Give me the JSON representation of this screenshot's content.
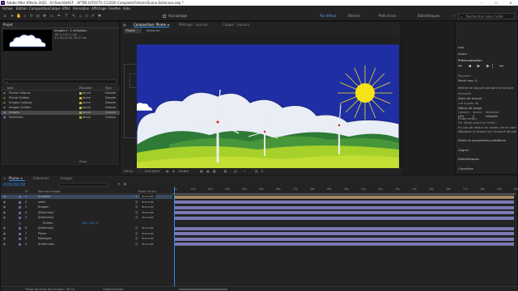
{
  "app": {
    "title": "Adobe After Effects 2022 - D:\\Teach\\HACF - AFTER EFFECTS CC2020 Complete\\Fichiers\\Scene Eoliennes.aep *",
    "logo_text": "Ae",
    "window_controls": [
      "–",
      "☐",
      "✕"
    ]
  },
  "menu": [
    "Fichier",
    "Edition",
    "Composition",
    "Calque",
    "Effet",
    "Animation",
    "Affichage",
    "Fenêtre",
    "Aide"
  ],
  "toolbar": {
    "snap_label": "Accrochage",
    "workspaces": [
      "Par défaut",
      "Réviser",
      "Petit écran",
      "Bibliothèques"
    ],
    "search_placeholder": "Rechercher dans l'aide"
  },
  "project_panel": {
    "tab": "Projet",
    "thumb_name": "Images ▾ , 2 utilisation",
    "thumb_info_1": "187 x 150 (1,00)",
    "thumb_info_2": "Δ 0;00;10;00, 29,97 ips",
    "search_placeholder": "",
    "columns": [
      "Nom",
      "Étiquette",
      "Type"
    ],
    "items": [
      {
        "name": "Plume Calques",
        "label": "Jaune",
        "type": "Dossier",
        "color": "#c9b23a"
      },
      {
        "name": "Plume Solides",
        "label": "Jaune",
        "type": "Dossier",
        "color": "#c9b23a"
      },
      {
        "name": "Images Calques",
        "label": "Jaune",
        "type": "Dossier",
        "color": "#c9b23a"
      },
      {
        "name": "Images Solides",
        "label": "Jaune",
        "type": "Dossier",
        "color": "#c9b23a"
      },
      {
        "name": "Images",
        "label": "Jaune",
        "type": "Compo",
        "color": "#9aa43b"
      },
      {
        "name": "Eoliennes",
        "label": "Jaune",
        "type": "Compo",
        "color": "#9aa43b"
      }
    ],
    "bottom": "8 bpc"
  },
  "composition": {
    "tabs": [
      "Composition: Plume ≡",
      "Métrage : (aucun)",
      "Calque : (aucun)"
    ],
    "sub_tabs": [
      "Plume",
      "Eoliennes"
    ],
    "zoom": "(50 %)",
    "quality": "Entière",
    "timecode": "0;00;00;00"
  },
  "timeline": {
    "tabs": [
      "Plume ≡",
      "Eoliennes",
      "Images"
    ],
    "timecode": "0;00;00;00",
    "columns": [
      "N°",
      "Nom des images",
      "Parent et lien"
    ],
    "layers": [
      {
        "num": "1",
        "name": "[Images]",
        "parent": "Aucun(e)",
        "color": "#6b6b9e",
        "selected": true
      },
      {
        "num": "2",
        "name": "soleil",
        "parent": "Aucun(e)",
        "color": "#6b6b9e"
      },
      {
        "num": "3",
        "name": "Nuages",
        "parent": "Aucun(e)",
        "color": "#6b6b9e"
      },
      {
        "num": "4",
        "name": "[Eoliennes]",
        "parent": "Aucun(e)",
        "color": "#6b6b9e"
      },
      {
        "num": "5",
        "name": "[Eoliennes]",
        "parent": "Aucun(e)",
        "color": "#6b6b9e"
      },
      {
        "num": "",
        "name": "Échelle",
        "parent": "",
        "color": "#3f3f3f",
        "value": "78,0 78,0 %"
      },
      {
        "num": "6",
        "name": "[Eoliennes]",
        "parent": "Aucun(e)",
        "color": "#6b6b9e"
      },
      {
        "num": "7",
        "name": "Plaine",
        "parent": "Aucun(e)",
        "color": "#6b6b9e"
      },
      {
        "num": "8",
        "name": "Montages",
        "parent": "Aucun(e)",
        "color": "#6b6b9e"
      },
      {
        "num": "9",
        "name": "Arrière plan",
        "parent": "Aucun(e)",
        "color": "#6b6b9e"
      }
    ],
    "ruler": [
      "0s",
      "01s",
      "02s",
      "03s",
      "04s",
      "05s",
      "06s",
      "07s",
      "08s",
      "09s",
      "10s",
      "11s",
      "12s",
      "13s",
      "14s",
      "15s",
      "16s",
      "17s",
      "18s",
      "19s",
      "20s"
    ],
    "footer_left": "Temps de rendu des images : 30 ms",
    "footer_mid": "Options/modes"
  },
  "right_panel": {
    "items": [
      "Info",
      "Audio",
      "Prévisualisation",
      "Raccourci",
      "Espace ▾",
      "Mettre en boucle",
      "Lecture sur la lecture",
      "Amorce",
      "Zone de travail ▾",
      "Vitesse",
      "Lire à partir de",
      "Début de la durée",
      "Ignorer",
      "Auto",
      "Plein écran",
      "Sur (Ech) ap",
      "En cas de",
      "Effets et paramètres prédéfinis",
      "Aligner",
      "Bibliothèques",
      "Caractère",
      "Paragraphe"
    ],
    "preview_title": "Prévisualisation",
    "shortcut_label": "Raccourci",
    "shortcut_value": "Pavé num. 0",
    "loop_checkbox": "Mettre en boucle pendant la lecture",
    "range_label": "Intervalle",
    "range_value": "Zone de travail",
    "play_from_label": "Lire à partir de",
    "play_from_value": "Début de plage",
    "framerate_label": "Cadence",
    "skip_label": "Ignorer",
    "resolution_label": "Résolution",
    "framerate_value": "(30)",
    "skip_value": "0",
    "resolution_value": "Intégrale",
    "fullscreen_label": "Écran entier",
    "stop_label": "Sur (Stop) quand (à l'arrêt) :",
    "stop_opt1": "En cas de retour en cache, lire le cache",
    "stop_opt2": "Déplacer le temps sur l'instant de prév",
    "sections": [
      "Effets et paramètres prédéfinis",
      "Aligner",
      "Bibliothèques",
      "Caractère",
      "Paragraphe"
    ]
  },
  "colors": {
    "accent_blue": "#2d8ceb",
    "sky": "#1f2ea4",
    "sun": "#f2e21a",
    "hill_dark": "#2e7a36",
    "grass": "#a6d12a",
    "track": "#7b78b4",
    "track_brown": "#a08a63"
  }
}
